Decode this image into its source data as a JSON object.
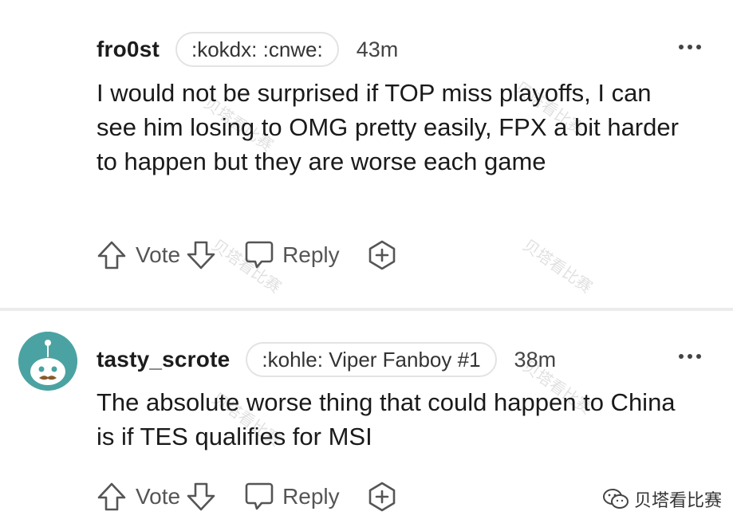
{
  "comments": [
    {
      "username": "fro0st",
      "flair": ":kokdx: :cnwe:",
      "time": "43m",
      "body": "I would not be surprised if TOP miss playoffs, I can see him losing to OMG pretty easily, FPX a bit harder to happen but they are worse each game",
      "vote_label": "Vote",
      "reply_label": "Reply"
    },
    {
      "username": "tasty_scrote",
      "flair": ":kohle: Viper Fanboy #1",
      "time": "38m",
      "body": "The absolute worse thing that could happen to China is if TES qualifies for MSI",
      "vote_label": "Vote",
      "reply_label": "Reply"
    }
  ],
  "watermark": {
    "text": "贝塔看比赛"
  },
  "colors": {
    "avatar_bg": "#4aa3a2",
    "divider": "#ececec",
    "icon_stroke": "#555555"
  }
}
